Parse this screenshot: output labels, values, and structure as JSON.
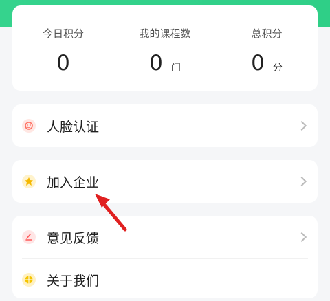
{
  "stats": {
    "today_points": {
      "label": "今日积分",
      "value": "0"
    },
    "my_courses": {
      "label": "我的课程数",
      "value": "0",
      "unit": "门"
    },
    "total_points": {
      "label": "总积分",
      "value": "0",
      "unit": "分"
    }
  },
  "menu": {
    "face_verify": {
      "label": "人脸认证",
      "icon": "face-icon",
      "color": "#ff8a80"
    },
    "join_company": {
      "label": "加入企业",
      "icon": "pin-icon",
      "color": "#ffcc33"
    },
    "feedback": {
      "label": "意见反馈",
      "icon": "feedback-icon",
      "color": "#ff6b6b"
    },
    "about_us": {
      "label": "关于我们",
      "icon": "globe-icon",
      "color": "#ffcc33"
    }
  },
  "annotation": {
    "arrow_color": "#e02020"
  }
}
